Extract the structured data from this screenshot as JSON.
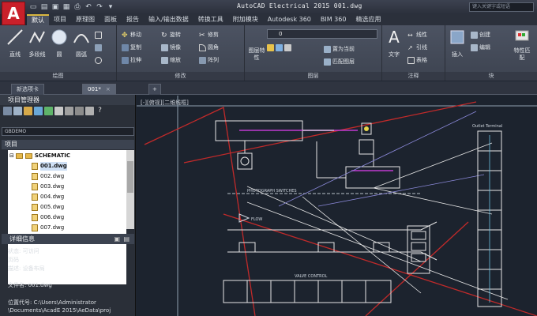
{
  "window": {
    "title": "AutoCAD Electrical 2015    001.dwg",
    "help_placeholder": "键入关键字或短语"
  },
  "ribbon_tabs": [
    "默认",
    "项目",
    "原理图",
    "面板",
    "报告",
    "输入/输出数据",
    "转换工具",
    "附加模块",
    "Autodesk 360",
    "BIM 360",
    "精选应用"
  ],
  "ribbon": {
    "draw": {
      "title": "绘图",
      "line": "直线",
      "polyline": "多段线",
      "circle": "圆",
      "arc": "圆弧"
    },
    "modify": {
      "title": "修改",
      "items": [
        "移动",
        "旋转",
        "修剪",
        "复制",
        "镜像",
        "圆角",
        "拉伸",
        "缩放",
        "阵列"
      ]
    },
    "layers": {
      "title": "图层",
      "layer_props": "图层特性",
      "current": "0",
      "set_current": "置为当前",
      "match": "匹配图层"
    },
    "annotation": {
      "title": "注释",
      "text": "文字",
      "linear": "线性",
      "leader": "引线",
      "table": "表格"
    },
    "block": {
      "title": "块",
      "insert": "插入",
      "create": "创建",
      "edit": "编辑",
      "match_props": "特性匹配"
    }
  },
  "doc_tabs": [
    "新选项卡",
    "001*"
  ],
  "project_manager": {
    "title": "项目管理器",
    "project_combo": "GBDEMO",
    "projects_header": "项目",
    "tree_root": "SCHEMATIC",
    "files": [
      "001.dwg",
      "002.dwg",
      "003.dwg",
      "004.dwg",
      "005.dwg",
      "006.dwg",
      "007.dwg"
    ]
  },
  "details": {
    "title": "详细信息",
    "status_label": "状态:",
    "status_value": "可访问",
    "page_label": "页码",
    "desc_label": "描述:",
    "desc_value": "设备布局",
    "filename_label": "文件名:",
    "filename_value": "001.dwg",
    "location_label": "位置代号:",
    "location_value": "C:\\Users\\Administrator",
    "location_value2": "\\Documents\\AcadE 2015\\AeData\\proj"
  },
  "viewport": {
    "label": "[-][俯视][二维线框]"
  },
  "drawing": {
    "outlet_label": "Outlet Terminal",
    "photo_label": "PHOTOGRAPH SWITCHES",
    "flow_label": "FLOW",
    "valve_label": "VALVE CONTROL"
  },
  "colors": {
    "accent_red": "#c9202a",
    "tab_active": "#d9b740"
  }
}
